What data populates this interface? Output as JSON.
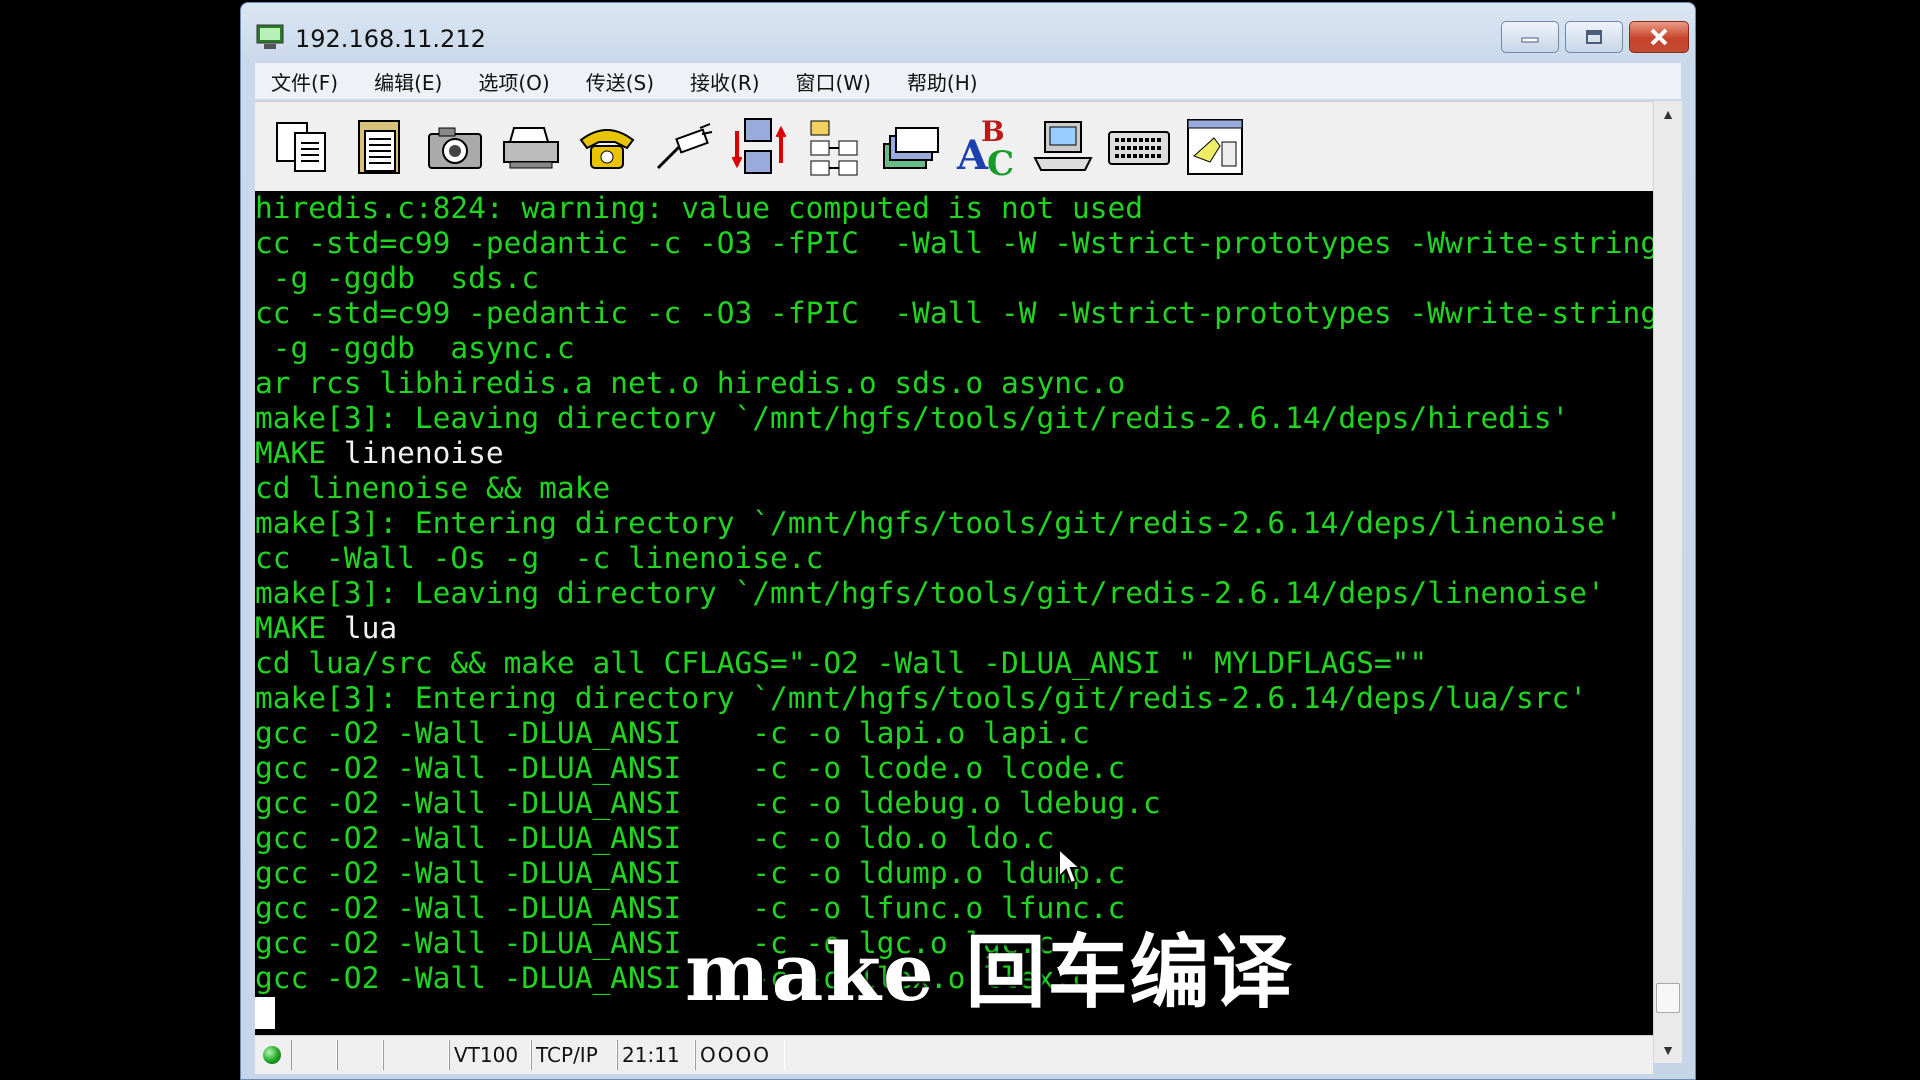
{
  "window": {
    "title": "192.168.11.212",
    "controls": [
      "minimize-icon",
      "maximize-icon",
      "close-icon"
    ]
  },
  "menu": [
    "文件(F)",
    "编辑(E)",
    "选项(O)",
    "传送(S)",
    "接收(R)",
    "窗口(W)",
    "帮助(H)"
  ],
  "toolbar": {
    "icons": [
      "copy-icon",
      "paste-icon",
      "camera-icon",
      "print-icon",
      "phone-icon",
      "disconnect-icon",
      "transfer-icon",
      "directory-icon",
      "sessions-icon",
      "font-icon",
      "terminal-setup-icon",
      "keyboard-icon",
      "log-icon"
    ]
  },
  "terminal": {
    "lines": [
      {
        "g": "hiredis.c:824: warning: value computed is not used",
        "w": ""
      },
      {
        "g": "cc -std=c99 -pedantic -c -O3 -fPIC  -Wall -W -Wstrict-prototypes -Wwrite-strings",
        "w": ""
      },
      {
        "g": " -g -ggdb  sds.c",
        "w": ""
      },
      {
        "g": "cc -std=c99 -pedantic -c -O3 -fPIC  -Wall -W -Wstrict-prototypes -Wwrite-strings",
        "w": ""
      },
      {
        "g": " -g -ggdb  async.c",
        "w": ""
      },
      {
        "g": "ar rcs libhiredis.a net.o hiredis.o sds.o async.o",
        "w": ""
      },
      {
        "g": "make[3]: Leaving directory `/mnt/hgfs/tools/git/redis-2.6.14/deps/hiredis'",
        "w": ""
      },
      {
        "g": "MAKE ",
        "w": "linenoise"
      },
      {
        "g": "cd linenoise && make",
        "w": ""
      },
      {
        "g": "make[3]: Entering directory `/mnt/hgfs/tools/git/redis-2.6.14/deps/linenoise'",
        "w": ""
      },
      {
        "g": "cc  -Wall -Os -g  -c linenoise.c",
        "w": ""
      },
      {
        "g": "make[3]: Leaving directory `/mnt/hgfs/tools/git/redis-2.6.14/deps/linenoise'",
        "w": ""
      },
      {
        "g": "MAKE ",
        "w": "lua"
      },
      {
        "g": "cd lua/src && make all CFLAGS=\"-O2 -Wall -DLUA_ANSI \" MYLDFLAGS=\"\"",
        "w": ""
      },
      {
        "g": "make[3]: Entering directory `/mnt/hgfs/tools/git/redis-2.6.14/deps/lua/src'",
        "w": ""
      },
      {
        "g": "gcc -O2 -Wall -DLUA_ANSI    -c -o lapi.o lapi.c",
        "w": ""
      },
      {
        "g": "gcc -O2 -Wall -DLUA_ANSI    -c -o lcode.o lcode.c",
        "w": ""
      },
      {
        "g": "gcc -O2 -Wall -DLUA_ANSI    -c -o ldebug.o ldebug.c",
        "w": ""
      },
      {
        "g": "gcc -O2 -Wall -DLUA_ANSI    -c -o ldo.o ldo.c",
        "w": ""
      },
      {
        "g": "gcc -O2 -Wall -DLUA_ANSI    -c -o ldump.o ldump.c",
        "w": ""
      },
      {
        "g": "gcc -O2 -Wall -DLUA_ANSI    -c -o lfunc.o lfunc.c",
        "w": ""
      },
      {
        "g": "gcc -O2 -Wall -DLUA_ANSI    -c -o lgc.o lgc.c",
        "w": ""
      },
      {
        "g": "gcc -O2 -Wall -DLUA_ANSI    -c -o llex.o llex.c",
        "w": ""
      }
    ],
    "text_color": "#22d422",
    "highlight_color": "#f2f2f2"
  },
  "subtitle": "make 回车编译",
  "statusbar": {
    "emulation": "VT100",
    "protocol": "TCP/IP",
    "cursor_pos": "21:11",
    "leds": "OOOO",
    "connected_color": "#1da21d"
  }
}
